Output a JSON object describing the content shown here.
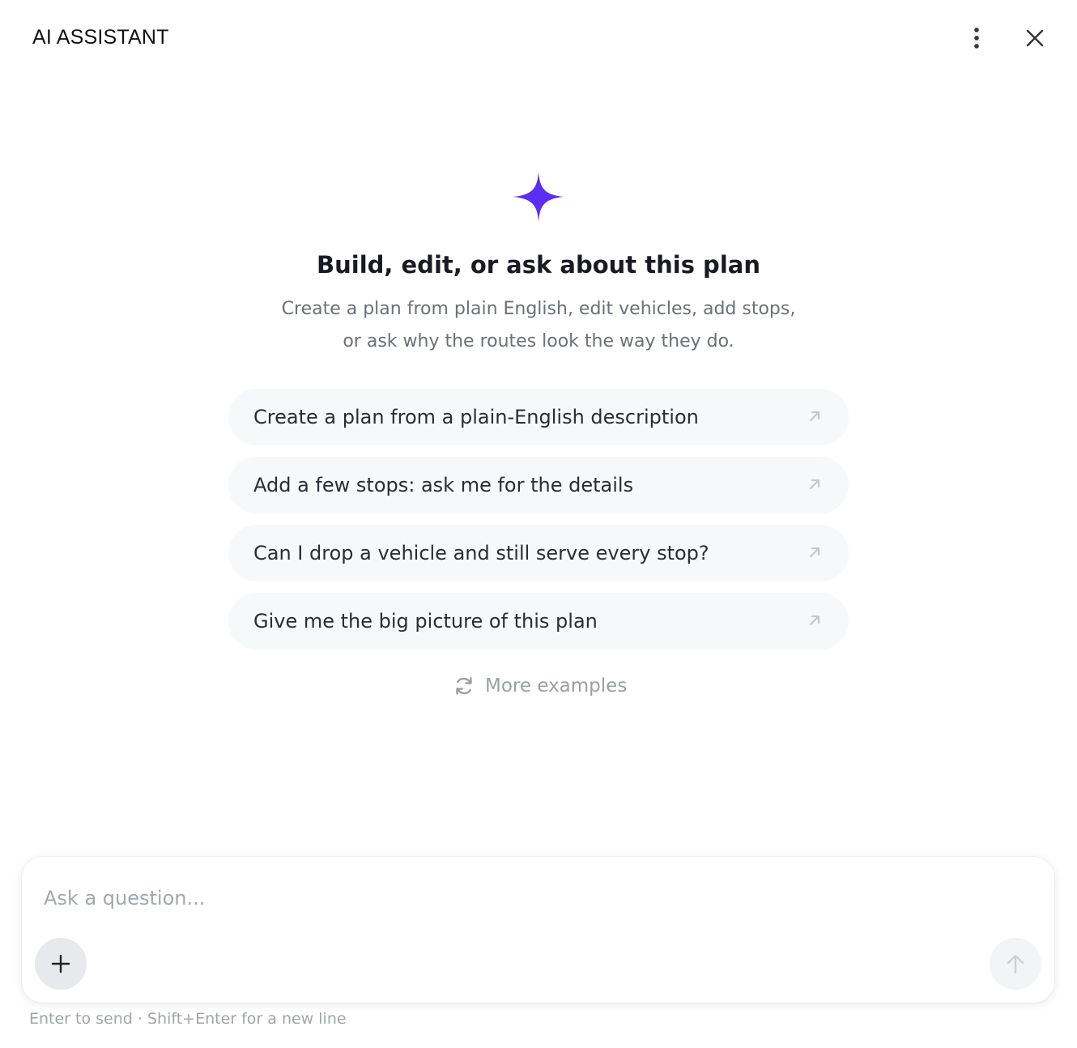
{
  "header": {
    "title": "AI ASSISTANT",
    "more_icon": "vertical-dots-icon",
    "close_icon": "close-icon"
  },
  "hero": {
    "icon": "sparkle-icon",
    "title": "Build, edit, or ask about this plan",
    "subtitle_line1": "Create a plan from plain English, edit vehicles, add stops,",
    "subtitle_line2": "or ask why the routes look the way they do."
  },
  "suggestions": [
    {
      "label": "Create a plan from a plain-English description",
      "icon": "arrow-up-right-icon"
    },
    {
      "label": "Add a few stops: ask me for the details",
      "icon": "arrow-up-right-icon"
    },
    {
      "label": "Can I drop a vehicle and still serve every stop?",
      "icon": "arrow-up-right-icon"
    },
    {
      "label": "Give me the big picture of this plan",
      "icon": "arrow-up-right-icon"
    }
  ],
  "more_examples": {
    "label": "More examples",
    "icon": "refresh-icon"
  },
  "composer": {
    "placeholder": "Ask a question...",
    "value": "",
    "attach_icon": "plus-icon",
    "send_icon": "arrow-up-icon"
  },
  "hint": "Enter to send · Shift+Enter for a new line",
  "colors": {
    "accent": "#5b2df5",
    "suggestion_bg": "#f7f8fa",
    "muted_text": "#6b6f78"
  }
}
